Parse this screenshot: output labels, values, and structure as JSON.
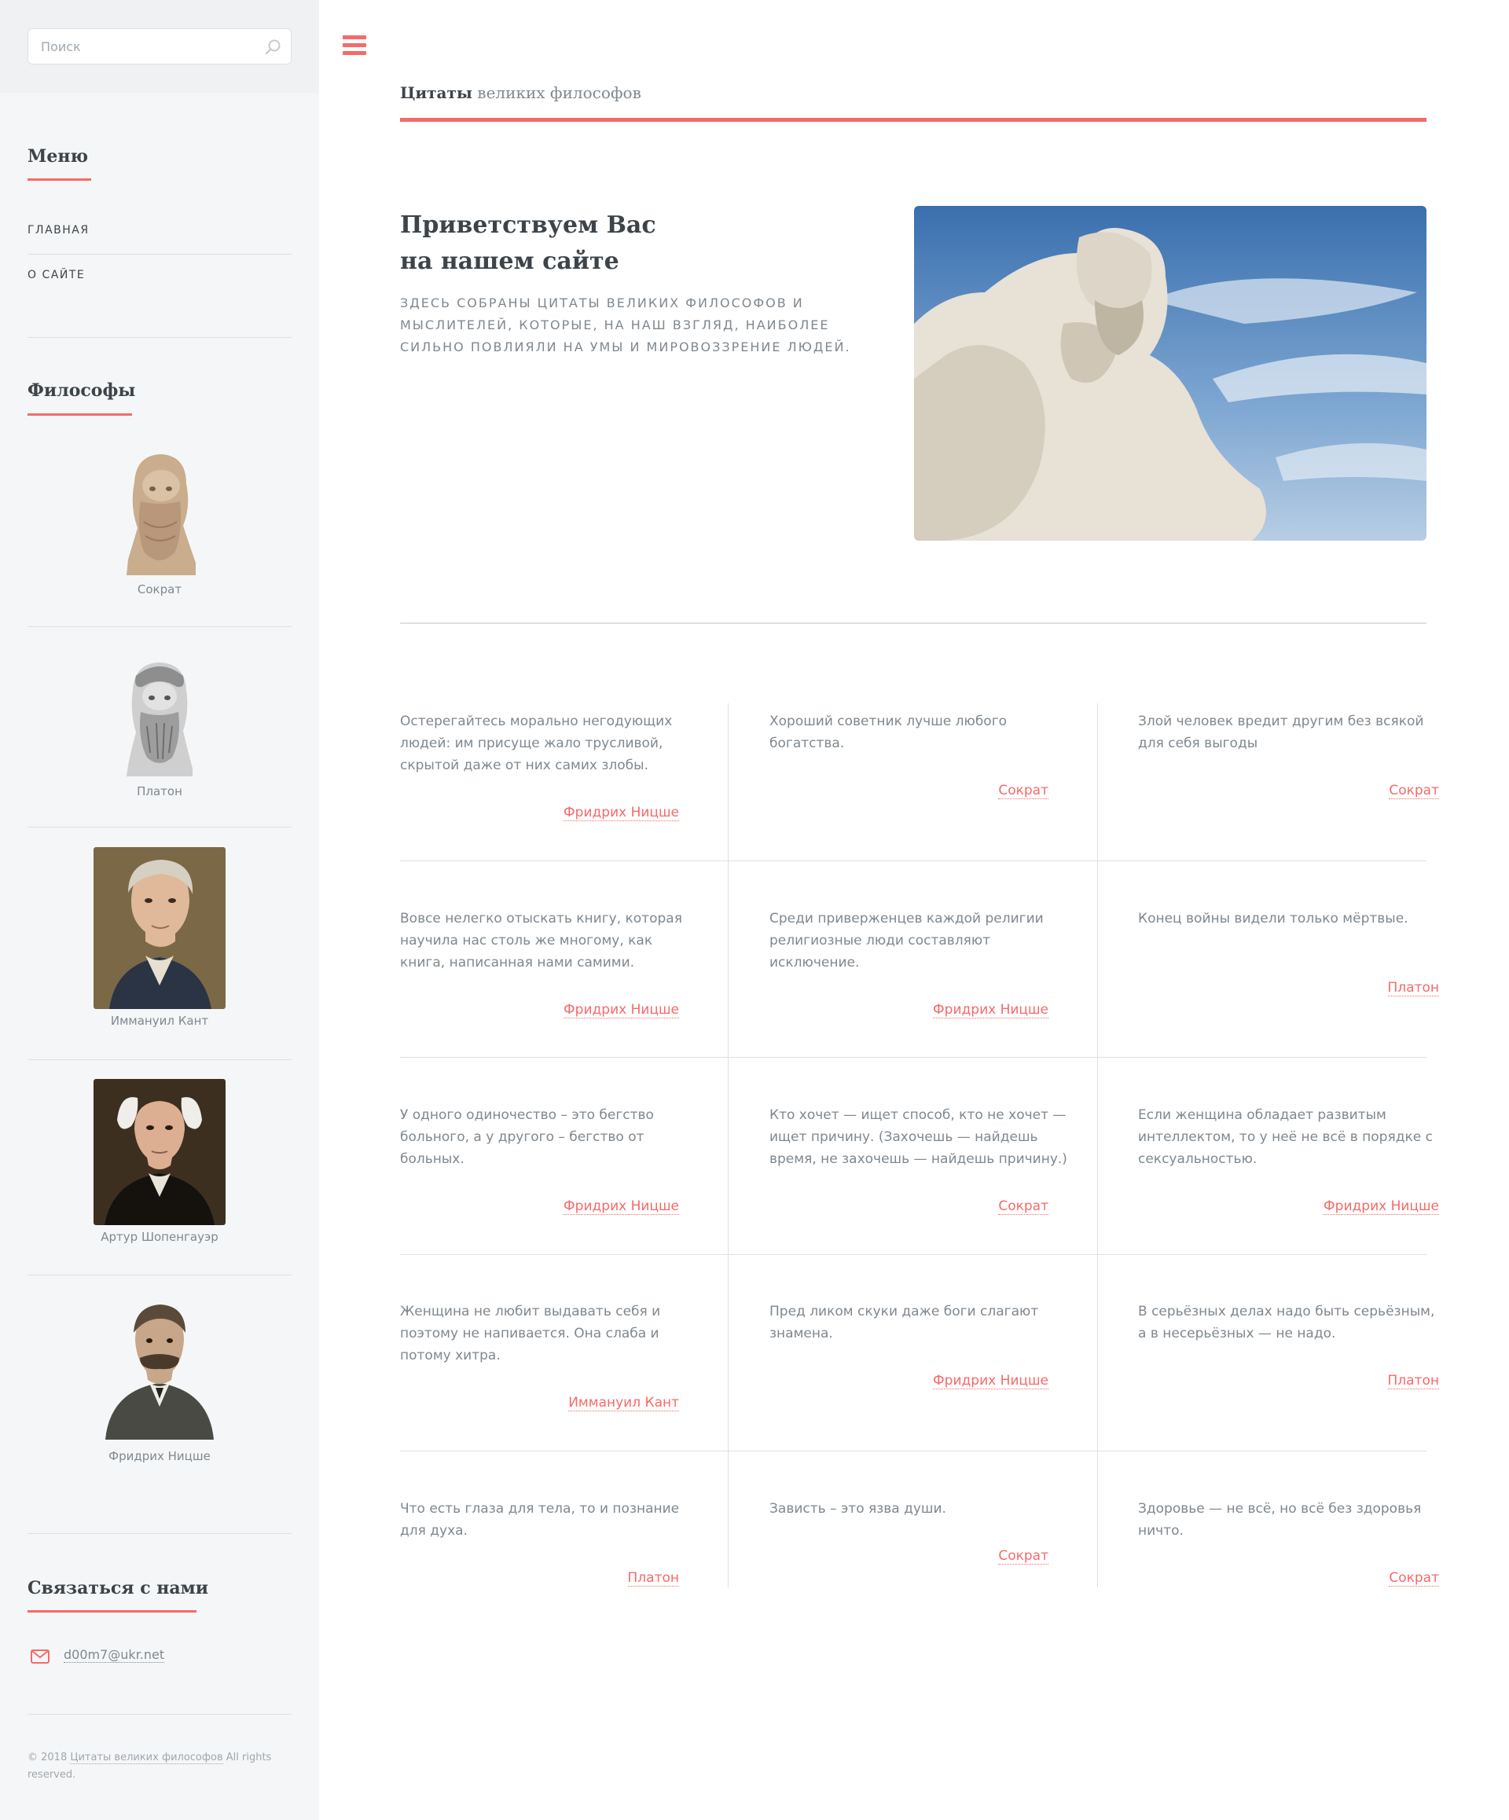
{
  "sidebar": {
    "search": {
      "placeholder": "Поиск",
      "icon": "search-icon"
    },
    "menu": {
      "heading": "Меню",
      "items": [
        {
          "label": "Главная"
        },
        {
          "label": "О сайте"
        }
      ]
    },
    "philosophers": {
      "heading": "Философы",
      "items": [
        {
          "name": "Сократ"
        },
        {
          "name": "Платон"
        },
        {
          "name": "Иммануил Кант"
        },
        {
          "name": "Артур Шопенгауэр"
        },
        {
          "name": "Фридрих Ницше"
        }
      ]
    },
    "contact": {
      "heading": "Связаться с нами",
      "email": "d00m7@ukr.net",
      "icon": "mail-icon"
    },
    "footer": {
      "prefix": "© 2018 ",
      "link": "Цитаты великих философов",
      "suffix": " All rights reserved."
    }
  },
  "header": {
    "title_bold": "Цитаты",
    "title_rest": " великих философов",
    "menu_icon": "hamburger-icon"
  },
  "banner": {
    "title_line1": "Приветствуем Вас",
    "title_line2": "на нашем сайте",
    "text": "Здесь собраны цитаты великих философов и мыслителей, которые, на наш взгляд, наиболее сильно повлияли на умы и мировоззрение людей."
  },
  "quotes": [
    {
      "text": "Остерегайтесь морально негодующих людей: им присуще жало трусливой, скрытой даже от них самих злобы.",
      "author": "Фридрих Ницше"
    },
    {
      "text": "Хороший советник лучше любого богатства.",
      "author": "Сократ"
    },
    {
      "text": "Злой человек вредит другим без всякой для себя выгоды",
      "author": "Сократ"
    },
    {
      "text": "Вовсе нелегко отыскать книгу, которая научила нас столь же многому, как книга, написанная нами самими.",
      "author": "Фридрих Ницше"
    },
    {
      "text": "Среди приверженцев каждой религии религиозные люди составляют исключение.",
      "author": "Фридрих Ницше"
    },
    {
      "text": "Конец войны видели только мёртвые.",
      "author": "Платон"
    },
    {
      "text": "У одного одиночество – это бегство больного, а у другого – бегство от больных.",
      "author": "Фридрих Ницше"
    },
    {
      "text": "Кто хочет — ищет способ, кто не хочет — ищет причину. (Захочешь — найдешь время, не захочешь — найдешь причину.)",
      "author": "Сократ"
    },
    {
      "text": "Если женщина обладает развитым интеллектом, то у неё не всё в порядке с сексуальностью.",
      "author": "Фридрих Ницше"
    },
    {
      "text": "Женщина не любит выдавать себя и поэтому не напивается. Она слаба и потому хитра.",
      "author": "Иммануил Кант"
    },
    {
      "text": "Пред ликом скуки даже боги слагают знамена.",
      "author": "Фридрих Ницше"
    },
    {
      "text": "В серьёзных делах надо быть серьёзным, а в несерьёзных — не надо.",
      "author": "Платон"
    },
    {
      "text": "Что есть глаза для тела, то и познание для духа.",
      "author": "Платон"
    },
    {
      "text": "Зависть – это язва души.",
      "author": "Сократ"
    },
    {
      "text": "Здоровье — не всё, но всё без здоровья ничто.",
      "author": "Сократ"
    }
  ],
  "colors": {
    "accent": "#f56a6a",
    "heading": "#3d4449",
    "text": "#7f888f",
    "sidebar_bg": "#f5f6f7"
  }
}
